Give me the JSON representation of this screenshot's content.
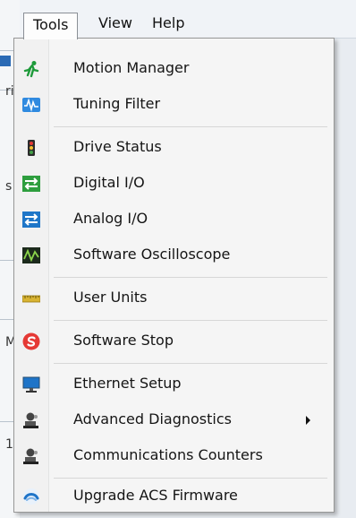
{
  "menubar": {
    "items": [
      {
        "label": "Tools"
      },
      {
        "label": "View"
      },
      {
        "label": "Help"
      }
    ]
  },
  "background": {
    "fragments": [
      "ri",
      "s",
      "M",
      "1"
    ]
  },
  "tools_menu": {
    "groups": [
      [
        {
          "label": "Motion Manager",
          "icon": "running-man-icon"
        },
        {
          "label": "Tuning Filter",
          "icon": "waveform-icon"
        }
      ],
      [
        {
          "label": "Drive Status",
          "icon": "traffic-light-icon"
        },
        {
          "label": "Digital I/O",
          "icon": "digital-io-icon"
        },
        {
          "label": "Analog I/O",
          "icon": "analog-io-icon"
        },
        {
          "label": "Software Oscilloscope",
          "icon": "oscilloscope-icon"
        }
      ],
      [
        {
          "label": "User Units",
          "icon": "ruler-icon"
        }
      ],
      [
        {
          "label": "Software Stop",
          "icon": "stop-icon"
        }
      ],
      [
        {
          "label": "Ethernet Setup",
          "icon": "monitor-icon"
        },
        {
          "label": "Advanced Diagnostics",
          "icon": "diagnostics-icon",
          "has_submenu": true
        },
        {
          "label": "Communications Counters",
          "icon": "diagnostics-icon"
        }
      ],
      [
        {
          "label": "Upgrade ACS Firmware",
          "icon": "firmware-icon"
        }
      ]
    ]
  }
}
